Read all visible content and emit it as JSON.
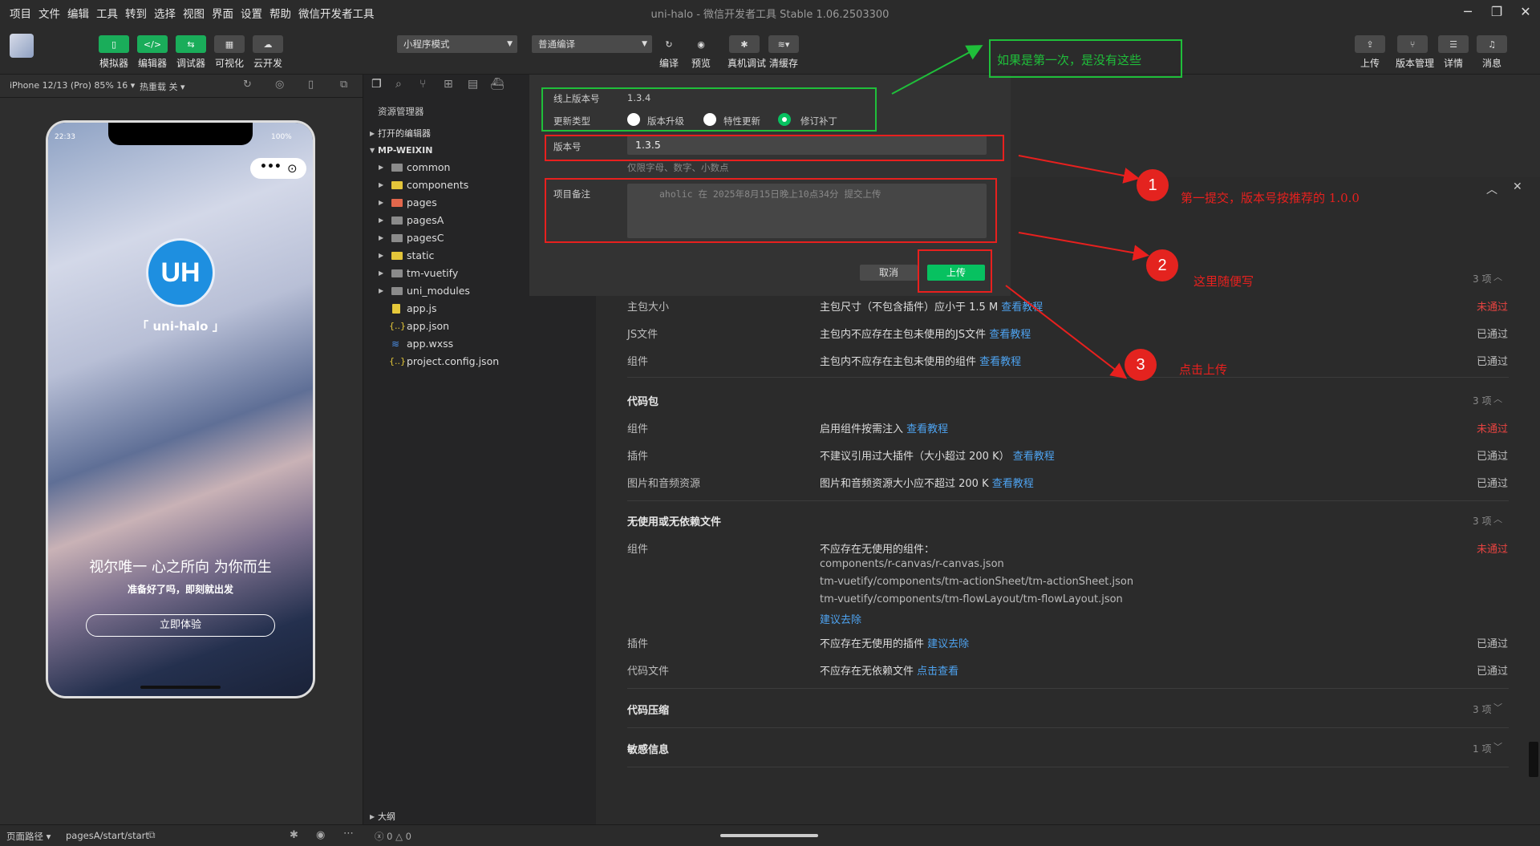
{
  "menubar": {
    "items": [
      "项目",
      "文件",
      "编辑",
      "工具",
      "转到",
      "选择",
      "视图",
      "界面",
      "设置",
      "帮助",
      "微信开发者工具"
    ],
    "window_title": "uni-halo - 微信开发者工具 Stable 1.06.2503300"
  },
  "toolbar": {
    "left_buttons": [
      "模拟器",
      "编辑器",
      "调试器",
      "可视化",
      "云开发"
    ],
    "mode_select": "小程序模式",
    "compile_select": "普通编译",
    "mid_buttons": [
      "编译",
      "预览",
      "真机调试",
      "清缓存"
    ],
    "right_buttons": [
      "上传",
      "版本管理",
      "详情",
      "消息"
    ]
  },
  "simulator": {
    "device": "iPhone 12/13 (Pro) 85% 16",
    "hot_reload": "热重载 关",
    "time": "22:33",
    "battery": "100%",
    "logo_text": "UH",
    "app_name": "「 uni-halo 」",
    "slogan": "视尔唯一 心之所向 为你而生",
    "sub_slogan": "准备好了吗，即刻就出发",
    "cta": "立即体验"
  },
  "explorer": {
    "title": "资源管理器",
    "open_editors": "打开的编辑器",
    "root": "MP-WEIXIN",
    "folders": [
      "common",
      "components",
      "pages",
      "pagesA",
      "pagesC",
      "static",
      "tm-vuetify",
      "uni_modules"
    ],
    "files": [
      "app.js",
      "app.json",
      "app.wxss",
      "project.config.json"
    ],
    "outline": "大纲"
  },
  "dialog": {
    "online_version_label": "线上版本号",
    "online_version": "1.3.4",
    "update_type_label": "更新类型",
    "update_types": [
      "版本升级",
      "特性更新",
      "修订补丁"
    ],
    "update_type_selected": 2,
    "version_label": "版本号",
    "version_value": "1.3.5",
    "version_hint": "仅限字母、数字、小数点",
    "note_label": "项目备注",
    "note_placeholder": "aholic 在 2025年8月15日晚上10点34分 提交上传",
    "cancel": "取消",
    "upload": "上传"
  },
  "analysis": {
    "sections": [
      {
        "title": "",
        "count": "3 项",
        "rows": [
          {
            "label": "主包大小",
            "desc": "主包尺寸（不包含插件）应小于 1.5 M",
            "link": "查看教程",
            "status": "未通过"
          },
          {
            "label": "JS文件",
            "desc": "主包内不应存在主包未使用的JS文件",
            "link": "查看教程",
            "status": "已通过"
          },
          {
            "label": "组件",
            "desc": "主包内不应存在主包未使用的组件",
            "link": "查看教程",
            "status": "已通过"
          }
        ]
      },
      {
        "title": "代码包",
        "count": "3 项",
        "rows": [
          {
            "label": "组件",
            "desc": "启用组件按需注入",
            "link": "查看教程",
            "status": "未通过"
          },
          {
            "label": "插件",
            "desc": "不建议引用过大插件（大小超过 200 K）",
            "link": "查看教程",
            "status": "已通过"
          },
          {
            "label": "图片和音频资源",
            "desc": "图片和音频资源大小应不超过 200 K",
            "link": "查看教程",
            "status": "已通过"
          }
        ]
      },
      {
        "title": "无使用或无依赖文件",
        "count": "3 项",
        "unused_component": {
          "label": "组件",
          "desc": "不应存在无使用的组件：",
          "files": [
            "components/r-canvas/r-canvas.json",
            "tm-vuetify/components/tm-actionSheet/tm-actionSheet.json",
            "tm-vuetify/components/tm-flowLayout/tm-flowLayout.json"
          ],
          "link": "建议去除",
          "status": "未通过"
        },
        "rows": [
          {
            "label": "插件",
            "desc": "不应存在无使用的插件",
            "link": "建议去除",
            "status": "已通过"
          },
          {
            "label": "代码文件",
            "desc": "不应存在无依赖文件",
            "link": "点击查看",
            "status": "已通过"
          }
        ]
      },
      {
        "title": "代码压缩",
        "count": "3 项"
      },
      {
        "title": "敏感信息",
        "count": "1 项"
      }
    ]
  },
  "annotations": {
    "top_note": "如果是第一次，是没有这些",
    "note1": "第一提交，版本号按推荐的 1.0.0",
    "note2": "这里随便写",
    "note3": "点击上传",
    "n1": "1",
    "n2": "2",
    "n3": "3"
  },
  "statusbar": {
    "path_label": "页面路径",
    "path": "pagesA/start/start",
    "errors": "0",
    "warnings": "0"
  }
}
